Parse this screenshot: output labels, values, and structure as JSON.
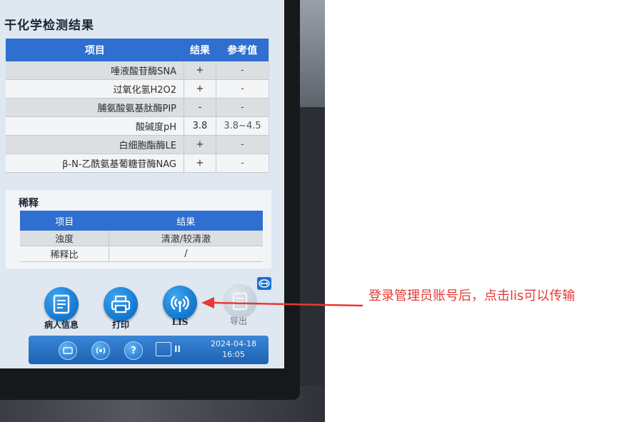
{
  "screen": {
    "title": "干化学检测结果"
  },
  "results_table": {
    "headers": [
      "项目",
      "结果",
      "参考值"
    ],
    "rows": [
      {
        "name": "唾液酸苷酶SNA",
        "result": "+",
        "ref": "-"
      },
      {
        "name": "过氧化氢H2O2",
        "result": "+",
        "ref": "-"
      },
      {
        "name": "脯氨酸氨基肽酶PIP",
        "result": "-",
        "ref": "-"
      },
      {
        "name": "酸碱度pH",
        "result": "3.8",
        "ref": "3.8~4.5"
      },
      {
        "name": "白细胞酯酶LE",
        "result": "+",
        "ref": "-"
      },
      {
        "name": "β-N-乙酰氨基葡糖苷酶NAG",
        "result": "+",
        "ref": "-"
      }
    ]
  },
  "dilution": {
    "title": "稀释",
    "headers": [
      "项目",
      "结果"
    ],
    "rows": [
      {
        "name": "浊度",
        "result": "清澈/较清澈"
      },
      {
        "name": "稀释比",
        "result": "/"
      }
    ]
  },
  "toolbar": {
    "patient_info": "病人信息",
    "print": "打印",
    "lis": "LIS",
    "export": "导出"
  },
  "statusbar": {
    "date": "2024-04-18",
    "time": "16:05",
    "indicator": "II"
  },
  "annotation": {
    "text": "登录管理员账号后，点击lis可以传输"
  },
  "colors": {
    "header_blue": "#2e6fcf",
    "positive_red": "#d63a3a",
    "annotation_red": "#e53935"
  }
}
